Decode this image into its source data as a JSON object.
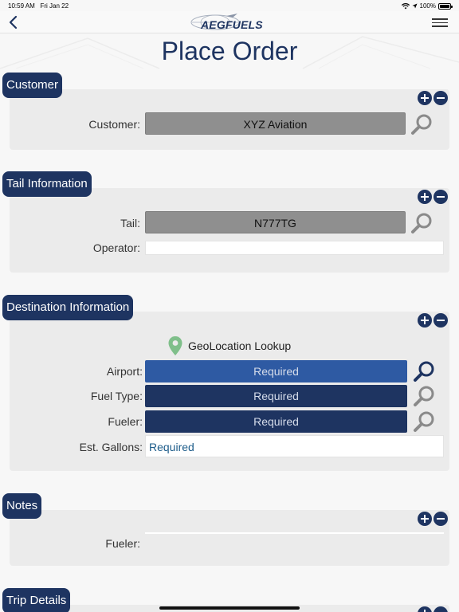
{
  "status_bar": {
    "time": "10:59 AM",
    "date": "Fri Jan 22",
    "battery": "100%",
    "battery_level": 1.0
  },
  "nav": {
    "logo_text": "AEGFUELS",
    "back_icon": "chevron-left-icon",
    "menu_icon": "hamburger-menu-icon"
  },
  "page": {
    "title": "Place Order"
  },
  "colors": {
    "navy": "#1e3461",
    "blue": "#2e5aa3",
    "field_gray": "#8f8f8f",
    "panel": "#ebebeb",
    "geo_pin": "#7fbf8a"
  },
  "customer": {
    "header": "Customer",
    "customer_label": "Customer:",
    "customer_value": "XYZ Aviation"
  },
  "tail": {
    "header": "Tail Information",
    "tail_label": "Tail:",
    "tail_value": "N777TG",
    "operator_label": "Operator:",
    "operator_value": ""
  },
  "destination": {
    "header": "Destination Information",
    "geo_label": "GeoLocation Lookup",
    "airport_label": "Airport:",
    "airport_value": "Required",
    "fuel_type_label": "Fuel Type:",
    "fuel_type_value": "Required",
    "fueler_label": "Fueler:",
    "fueler_value": "Required",
    "gallons_label": "Est. Gallons:",
    "gallons_value": "Required"
  },
  "notes": {
    "header": "Notes",
    "fueler_label": "Fueler:",
    "fueler_value": ""
  },
  "trip": {
    "header": "Trip Details"
  }
}
